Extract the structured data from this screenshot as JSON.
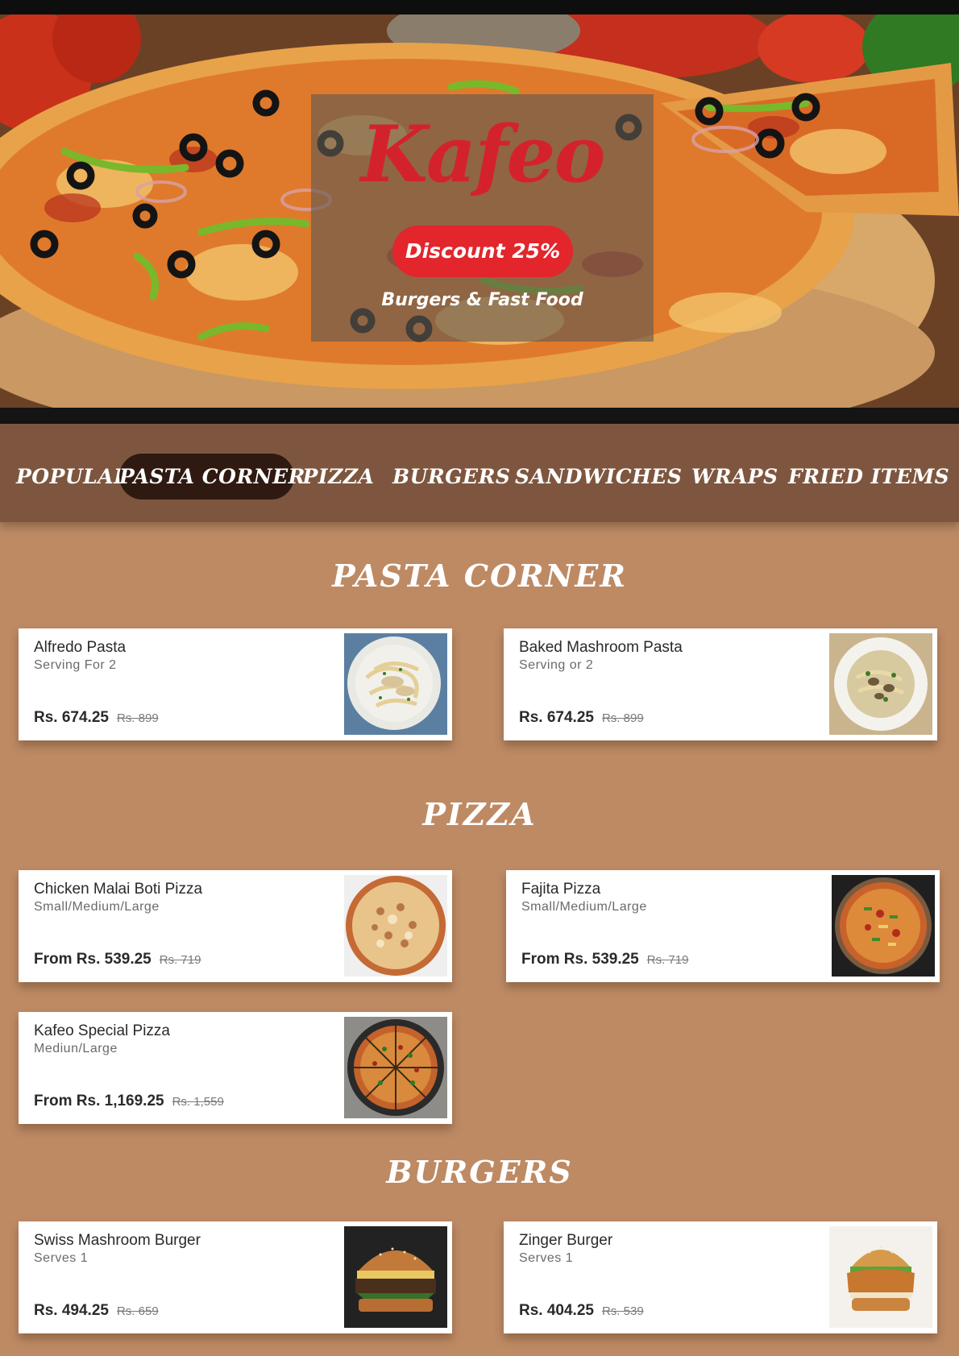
{
  "hero": {
    "brand": "Kafeo",
    "discount": "Discount 25%",
    "tagline": "Burgers & Fast Food"
  },
  "nav": {
    "items": [
      {
        "label": "POPULAR",
        "active": false
      },
      {
        "label": "PASTA CORNER",
        "active": true
      },
      {
        "label": "PIZZA",
        "active": false
      },
      {
        "label": "BURGERS",
        "active": false
      },
      {
        "label": "SANDWICHES",
        "active": false
      },
      {
        "label": "WRAPS",
        "active": false
      },
      {
        "label": "FRIED ITEMS",
        "active": false
      }
    ]
  },
  "sections": [
    {
      "title": "PASTA CORNER",
      "items": [
        {
          "name": "Alfredo Pasta",
          "sub": "Serving For 2",
          "price": "Rs. 674.25",
          "old": "Rs. 899",
          "image": "alfredo-pasta-image"
        },
        {
          "name": "Baked Mashroom Pasta",
          "sub": "Serving or 2",
          "price": "Rs. 674.25",
          "old": "Rs. 899",
          "image": "mushroom-pasta-image"
        }
      ]
    },
    {
      "title": "PIZZA",
      "items": [
        {
          "name": "Chicken Malai Boti Pizza",
          "sub": "Small/Medium/Large",
          "price": "From Rs. 539.25",
          "old": "Rs. 719",
          "image": "malai-boti-pizza-image"
        },
        {
          "name": "Fajita Pizza",
          "sub": "Small/Medium/Large",
          "price": "From Rs. 539.25",
          "old": "Rs. 719",
          "image": "fajita-pizza-image"
        },
        {
          "name": "Kafeo Special Pizza",
          "sub": "Mediun/Large",
          "price": "From Rs. 1,169.25",
          "old": "Rs. 1,559",
          "image": "special-pizza-image"
        }
      ]
    },
    {
      "title": "BURGERS",
      "items": [
        {
          "name": "Swiss Mashroom Burger",
          "sub": "Serves 1",
          "price": "Rs. 494.25",
          "old": "Rs. 659",
          "image": "swiss-burger-image"
        },
        {
          "name": "Zinger Burger",
          "sub": "Serves 1",
          "price": "Rs. 404.25",
          "old": "Rs. 539",
          "image": "zinger-burger-image"
        }
      ]
    }
  ],
  "colors": {
    "page_bg": "#bd8a64",
    "nav_bg": "#7e563f",
    "nav_active": "#2f1a11",
    "brand_red": "#d4222d",
    "pill_red": "#e3252c"
  }
}
